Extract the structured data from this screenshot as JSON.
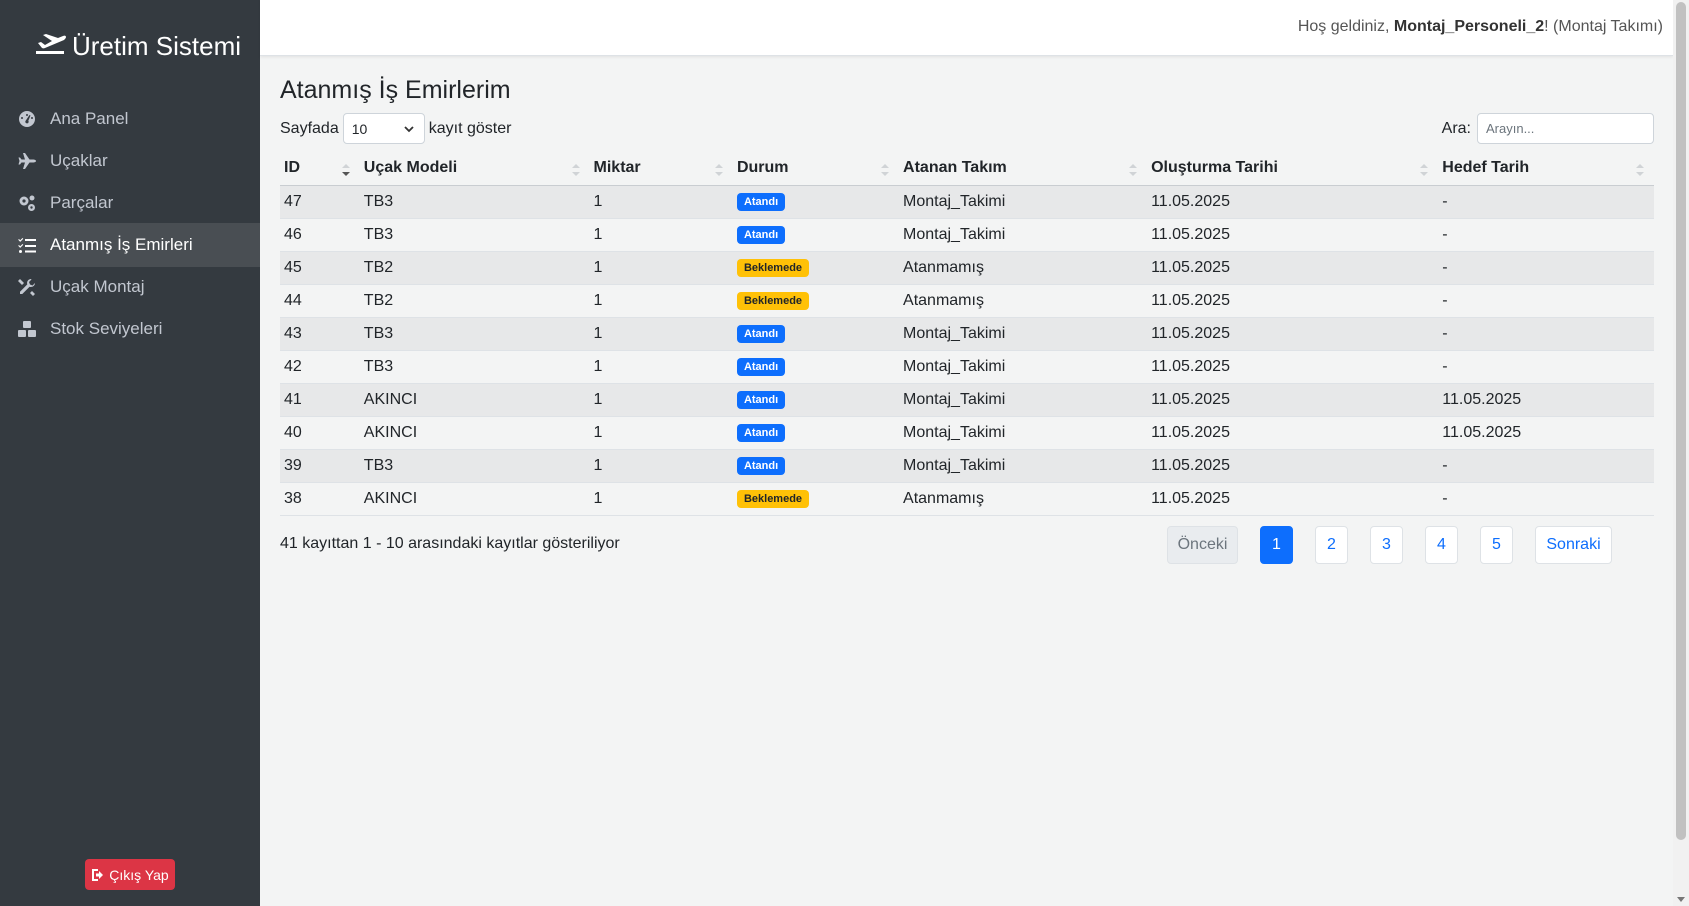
{
  "brand": {
    "title": "Üretim Sistemi",
    "icon": "plane-departure-icon"
  },
  "sidebar": {
    "items": [
      {
        "label": "Ana Panel",
        "icon": "tachometer-icon",
        "active": false
      },
      {
        "label": "Uçaklar",
        "icon": "plane-icon",
        "active": false
      },
      {
        "label": "Parçalar",
        "icon": "cogs-icon",
        "active": false
      },
      {
        "label": "Atanmış İş Emirleri",
        "icon": "list-check-icon",
        "active": true
      },
      {
        "label": "Uçak Montaj",
        "icon": "tools-icon",
        "active": false
      },
      {
        "label": "Stok Seviyeleri",
        "icon": "boxes-icon",
        "active": false
      }
    ],
    "logout_label": "Çıkış Yap"
  },
  "header": {
    "greeting": "Hoş geldiniz,",
    "username": "Montaj_Personeli_2",
    "suffix": "! (Montaj Takımı)"
  },
  "page": {
    "title": "Atanmış İş Emirlerim",
    "length_prefix": "Sayfada",
    "length_value": "10",
    "length_suffix": "kayıt göster",
    "search_label": "Ara:",
    "search_placeholder": "Arayın...",
    "info": "41 kayıttan 1 - 10 arasındaki kayıtlar gösteriliyor"
  },
  "table": {
    "columns": [
      "ID",
      "Uçak Modeli",
      "Miktar",
      "Durum",
      "Atanan Takım",
      "Oluşturma Tarihi",
      "Hedef Tarih"
    ],
    "rows": [
      {
        "id": "47",
        "model": "TB3",
        "qty": "1",
        "status": "Atandı",
        "status_type": "blue",
        "team": "Montaj_Takimi",
        "created": "11.05.2025",
        "target": "-"
      },
      {
        "id": "46",
        "model": "TB3",
        "qty": "1",
        "status": "Atandı",
        "status_type": "blue",
        "team": "Montaj_Takimi",
        "created": "11.05.2025",
        "target": "-"
      },
      {
        "id": "45",
        "model": "TB2",
        "qty": "1",
        "status": "Beklemede",
        "status_type": "yellow",
        "team": "Atanmamış",
        "created": "11.05.2025",
        "target": "-"
      },
      {
        "id": "44",
        "model": "TB2",
        "qty": "1",
        "status": "Beklemede",
        "status_type": "yellow",
        "team": "Atanmamış",
        "created": "11.05.2025",
        "target": "-"
      },
      {
        "id": "43",
        "model": "TB3",
        "qty": "1",
        "status": "Atandı",
        "status_type": "blue",
        "team": "Montaj_Takimi",
        "created": "11.05.2025",
        "target": "-"
      },
      {
        "id": "42",
        "model": "TB3",
        "qty": "1",
        "status": "Atandı",
        "status_type": "blue",
        "team": "Montaj_Takimi",
        "created": "11.05.2025",
        "target": "-"
      },
      {
        "id": "41",
        "model": "AKINCI",
        "qty": "1",
        "status": "Atandı",
        "status_type": "blue",
        "team": "Montaj_Takimi",
        "created": "11.05.2025",
        "target": "11.05.2025"
      },
      {
        "id": "40",
        "model": "AKINCI",
        "qty": "1",
        "status": "Atandı",
        "status_type": "blue",
        "team": "Montaj_Takimi",
        "created": "11.05.2025",
        "target": "11.05.2025"
      },
      {
        "id": "39",
        "model": "TB3",
        "qty": "1",
        "status": "Atandı",
        "status_type": "blue",
        "team": "Montaj_Takimi",
        "created": "11.05.2025",
        "target": "-"
      },
      {
        "id": "38",
        "model": "AKINCI",
        "qty": "1",
        "status": "Beklemede",
        "status_type": "yellow",
        "team": "Atanmamış",
        "created": "11.05.2025",
        "target": "-"
      }
    ]
  },
  "pagination": {
    "prev": "Önceki",
    "pages": [
      "1",
      "2",
      "3",
      "4",
      "5"
    ],
    "current": "1",
    "next": "Sonraki"
  },
  "colors": {
    "sidebar_bg": "#343a40",
    "primary": "#0d6efd",
    "warning": "#ffc107",
    "danger": "#dc3545"
  }
}
